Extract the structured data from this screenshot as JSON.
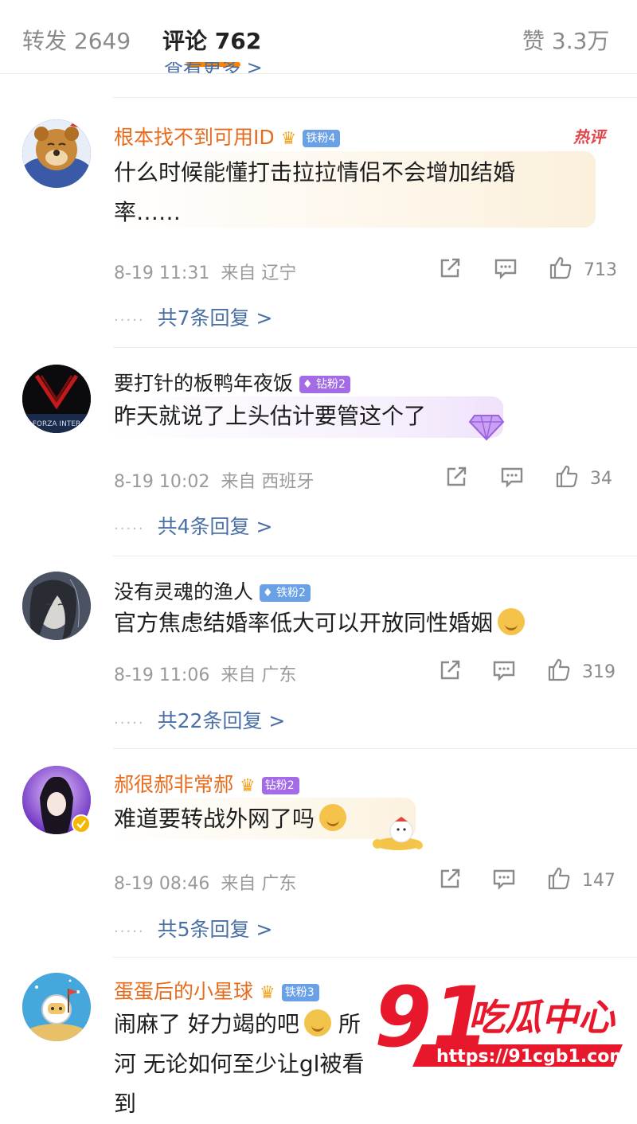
{
  "header": {
    "tabs": [
      {
        "label": "转发 2649"
      },
      {
        "label": "评论 762"
      },
      {
        "label": "赞 3.3万"
      }
    ],
    "peek_text": "查看更多 >"
  },
  "colors": {
    "accent": "#ff8200",
    "link": "#4a6fa5",
    "vip_name": "#e86b1c"
  },
  "comments": [
    {
      "name": "根本找不到可用ID",
      "badge": "铁粉4",
      "hot_label": "热评",
      "text": "什么时候能懂打击拉拉情侣不会增加结婚率……",
      "time": "8-19 11:31",
      "from": "来自 辽宁",
      "likes": "713",
      "replies": "共7条回复 >"
    },
    {
      "name": "要打针的板鸭年夜饭",
      "badge": "钻粉2",
      "avatar_text": "FORZA INTER",
      "text": "昨天就说了上头估计要管这个了",
      "time": "8-19 10:02",
      "from": "来自 西班牙",
      "likes": "34",
      "replies": "共4条回复 >"
    },
    {
      "name": "没有灵魂的渔人",
      "badge": "铁粉2",
      "text": "官方焦虑结婚率低大可以开放同性婚姻",
      "time": "8-19 11:06",
      "from": "来自 广东",
      "likes": "319",
      "replies": "共22条回复 >"
    },
    {
      "name": "郝很郝非常郝",
      "badge": "钻粉2",
      "text": "难道要转战外网了吗",
      "time": "8-19 08:46",
      "from": "来自 广东",
      "likes": "147",
      "replies": "共5条回复 >"
    },
    {
      "name": "蛋蛋后的小星球",
      "badge": "铁粉3",
      "text_a": "闹麻了 好力竭的吧",
      "text_b": "所",
      "text_line2": "河 无论如何至少让gl被看到"
    }
  ],
  "watermark": {
    "number": "91",
    "brand": "吃瓜中心",
    "url": "https://91cgb1.com"
  }
}
